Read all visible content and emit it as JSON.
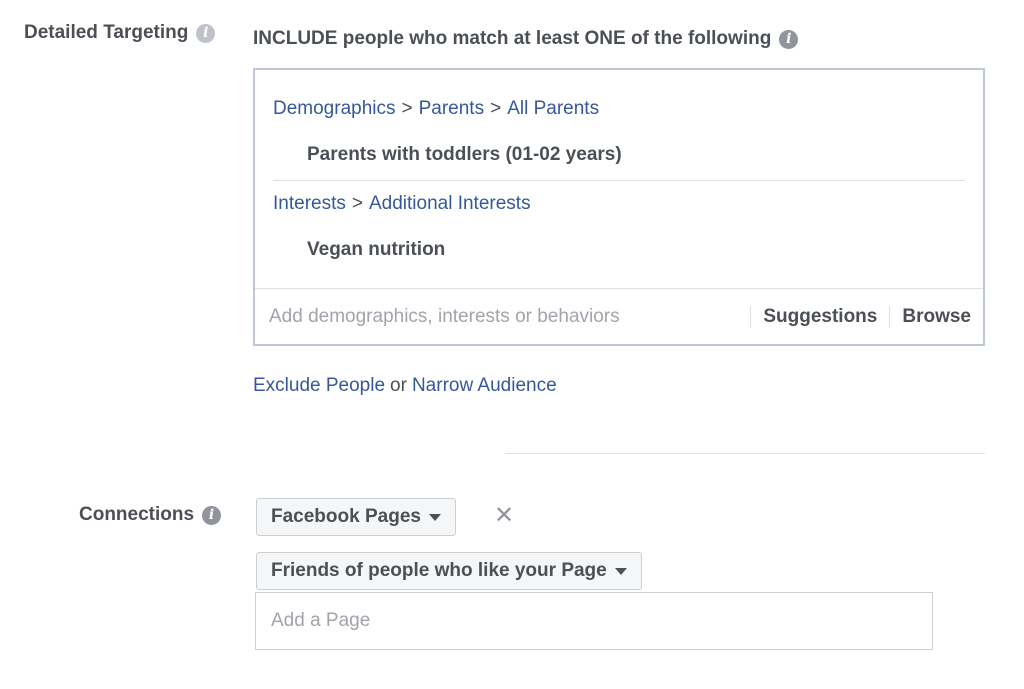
{
  "detailed_targeting": {
    "label": "Detailed Targeting",
    "include_text": "INCLUDE people who match at least ONE of the following",
    "groups": [
      {
        "path": [
          "Demographics",
          "Parents",
          "All Parents"
        ],
        "item": "Parents with toddlers (01-02 years)"
      },
      {
        "path": [
          "Interests",
          "Additional Interests"
        ],
        "item": "Vegan nutrition"
      }
    ],
    "path_separator": ">",
    "search_placeholder": "Add demographics, interests or behaviors",
    "suggestions_label": "Suggestions",
    "browse_label": "Browse",
    "exclude_label": "Exclude People",
    "or_text": "or",
    "narrow_label": "Narrow Audience"
  },
  "connections": {
    "label": "Connections",
    "type_dropdown": "Facebook Pages",
    "remove_symbol": "✕",
    "scope_dropdown": "Friends of people who like your Page",
    "page_placeholder": "Add a Page"
  },
  "icons": {
    "info": "info-icon",
    "caret": "caret-down-icon",
    "close": "close-icon"
  },
  "colors": {
    "link": "#365899",
    "text": "#4b4f56",
    "border": "#bdc7d8",
    "placeholder": "#a0a4ab"
  }
}
